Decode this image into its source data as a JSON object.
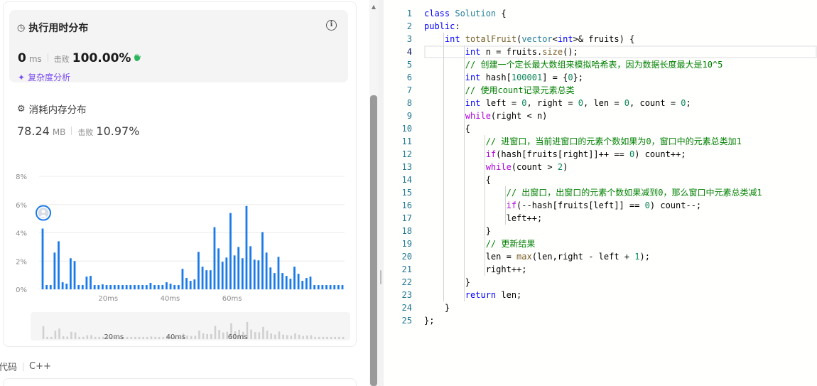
{
  "runtime": {
    "title": "执行用时分布",
    "value": "0",
    "unit": "ms",
    "beats_label": "击败",
    "beats_value": "100.00%",
    "complexity_link": "复杂度分析",
    "title_icon": "clock-icon",
    "info_icon": "info-icon",
    "badge_icon": "clapping-hands-icon"
  },
  "memory": {
    "title": "消耗内存分布",
    "value": "78.24",
    "unit": "MB",
    "beats_label": "击败",
    "beats_value": "10.97%",
    "title_icon": "memory-chip-icon"
  },
  "chart_data": {
    "type": "bar",
    "title": "",
    "xlabel": "",
    "ylabel": "",
    "y_ticks": [
      "8%",
      "6%",
      "4%",
      "2%",
      "0%"
    ],
    "x_ticks": [
      "20ms",
      "40ms",
      "60ms"
    ],
    "ylim": [
      0,
      8
    ],
    "xlim": [
      0,
      76
    ],
    "bar_color": "#1a7ae8",
    "grid": true,
    "values": [
      4.3,
      0.3,
      0.3,
      2.6,
      3.4,
      0.5,
      0.4,
      2.2,
      2.0,
      0.3,
      0.3,
      0.9,
      0.95,
      0.3,
      0.3,
      0.35,
      0.3,
      0.3,
      0.3,
      0.3,
      0.3,
      0.3,
      0.3,
      0.3,
      0.3,
      0.3,
      0.3,
      0.45,
      0.3,
      0.3,
      0.3,
      0.5,
      0.4,
      0.3,
      0.3,
      1.45,
      0.8,
      0.6,
      0.7,
      2.65,
      1.6,
      1.35,
      1.35,
      4.4,
      2.9,
      1.95,
      2.25,
      5.4,
      2.4,
      3.0,
      2.2,
      5.9,
      3.05,
      2.1,
      2.05,
      4.05,
      2.6,
      1.55,
      1.15,
      2.3,
      1.15,
      0.95,
      0.75,
      1.6,
      1.1,
      0.6,
      0.8,
      0.9,
      0.3,
      0.3,
      0.3,
      0.3,
      0.3,
      0.3,
      0.3,
      0.3
    ],
    "marker": {
      "label": "current-submission",
      "x_index": 0
    }
  },
  "footer": {
    "code_label": "代码",
    "language": "C++"
  },
  "editor": {
    "active_line": 4,
    "lines": [
      {
        "n": "1",
        "text": "class Solution {"
      },
      {
        "n": "2",
        "text": "public:"
      },
      {
        "n": "3",
        "text": "    int totalFruit(vector<int>& fruits) {"
      },
      {
        "n": "4",
        "text": "        int n = fruits.size();"
      },
      {
        "n": "5",
        "text": "        // 创建一个定长最大数组来模拟哈希表，因为数据长度最大是10^5"
      },
      {
        "n": "6",
        "text": "        int hash[100001] = {0};"
      },
      {
        "n": "7",
        "text": "        // 使用count记录元素总类"
      },
      {
        "n": "8",
        "text": "        int left = 0, right = 0, len = 0, count = 0;"
      },
      {
        "n": "9",
        "text": "        while(right < n)"
      },
      {
        "n": "10",
        "text": "        {"
      },
      {
        "n": "11",
        "text": "            // 进窗口，当前进窗口的元素个数如果为0，窗口中的元素总类加1"
      },
      {
        "n": "12",
        "text": "            if(hash[fruits[right]]++ == 0) count++;"
      },
      {
        "n": "13",
        "text": "            while(count > 2)"
      },
      {
        "n": "14",
        "text": "            {"
      },
      {
        "n": "15",
        "text": "                // 出窗口，出窗口的元素个数如果减到0，那么窗口中元素总类减1"
      },
      {
        "n": "16",
        "text": "                if(--hash[fruits[left]] == 0) count--;"
      },
      {
        "n": "17",
        "text": "                left++;"
      },
      {
        "n": "18",
        "text": "            }"
      },
      {
        "n": "19",
        "text": "            // 更新结果"
      },
      {
        "n": "20",
        "text": "            len = max(len,right - left + 1);"
      },
      {
        "n": "21",
        "text": "            right++;"
      },
      {
        "n": "22",
        "text": "        }"
      },
      {
        "n": "23",
        "text": "        return len;"
      },
      {
        "n": "24",
        "text": "    }"
      },
      {
        "n": "25",
        "text": "};"
      }
    ]
  }
}
